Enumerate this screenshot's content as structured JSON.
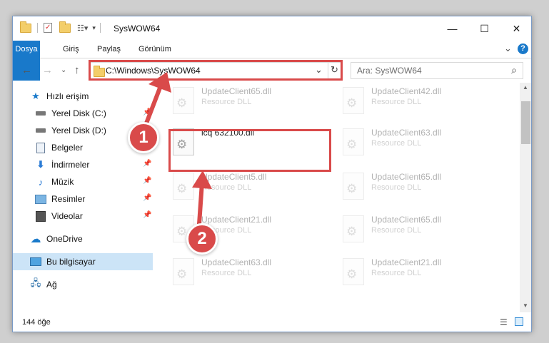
{
  "window": {
    "title": "SysWOW64",
    "minimize": "—",
    "maximize": "☐",
    "close": "✕"
  },
  "ribbon": {
    "tabs": [
      "Dosya",
      "Giriş",
      "Paylaş",
      "Görünüm"
    ],
    "expand": "⌄",
    "help": "?"
  },
  "address": {
    "path": "C:\\Windows\\SysWOW64",
    "dropdown": "⌄",
    "refresh": "↻"
  },
  "search": {
    "placeholder": "Ara: SysWOW64",
    "icon": "⌕"
  },
  "nav": {
    "back": "←",
    "forward": "→",
    "recent": "⌄",
    "up": "↑",
    "items": [
      {
        "label": "Hızlı erişim",
        "icon": "star-icon"
      },
      {
        "label": "Yerel Disk (C:)",
        "icon": "drive-icon"
      },
      {
        "label": "Yerel Disk (D:)",
        "icon": "drive-icon"
      },
      {
        "label": "Belgeler",
        "icon": "document-icon"
      },
      {
        "label": "İndirmeler",
        "icon": "download-icon"
      },
      {
        "label": "Müzik",
        "icon": "music-icon"
      },
      {
        "label": "Resimler",
        "icon": "pictures-icon"
      },
      {
        "label": "Videolar",
        "icon": "video-icon"
      },
      {
        "label": "OneDrive",
        "icon": "cloud-icon"
      },
      {
        "label": "Bu bilgisayar",
        "icon": "computer-icon"
      },
      {
        "label": "Ağ",
        "icon": "network-icon"
      }
    ]
  },
  "files": [
    {
      "name": "UpdateClient65.dll",
      "desc": "Resource DLL"
    },
    {
      "name": "UpdateClient42.dll",
      "desc": "Resource DLL"
    },
    {
      "name": "icq 632100.dll",
      "desc": ""
    },
    {
      "name": "UpdateClient63.dll",
      "desc": "Resource DLL"
    },
    {
      "name": "UpdateClient5.dll",
      "desc": "Resource DLL"
    },
    {
      "name": "UpdateClient65.dll",
      "desc": "Resource DLL"
    },
    {
      "name": "UpdateClient21.dll",
      "desc": "Resource DLL"
    },
    {
      "name": "UpdateClient65.dll",
      "desc": "Resource DLL"
    },
    {
      "name": "UpdateClient63.dll",
      "desc": "Resource DLL"
    },
    {
      "name": "UpdateClient21.dll",
      "desc": "Resource DLL"
    }
  ],
  "status": {
    "count": "144 öğe"
  },
  "annotations": {
    "step1": "1",
    "step2": "2",
    "color": "#d94a4a"
  }
}
